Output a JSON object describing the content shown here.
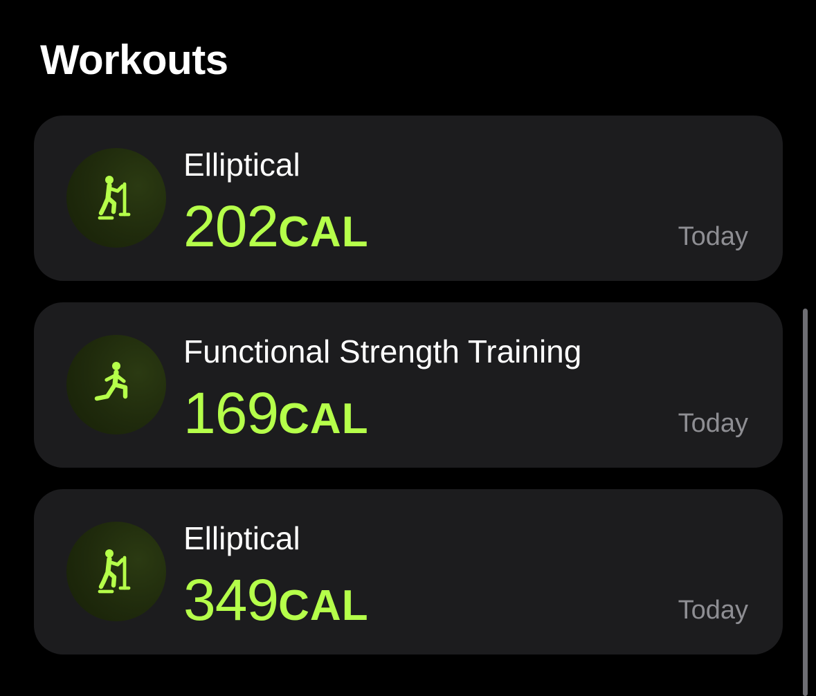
{
  "section": {
    "title": "Workouts"
  },
  "workouts": [
    {
      "name": "Elliptical",
      "calories": "202",
      "unit": "CAL",
      "date": "Today",
      "icon": "elliptical-icon"
    },
    {
      "name": "Functional Strength Training",
      "calories": "169",
      "unit": "CAL",
      "date": "Today",
      "icon": "strength-training-icon"
    },
    {
      "name": "Elliptical",
      "calories": "349",
      "unit": "CAL",
      "date": "Today",
      "icon": "elliptical-icon"
    }
  ],
  "colors": {
    "background": "#000000",
    "card": "#1c1c1e",
    "accent": "#b5ff4a",
    "secondary_text": "#8e8e93"
  }
}
